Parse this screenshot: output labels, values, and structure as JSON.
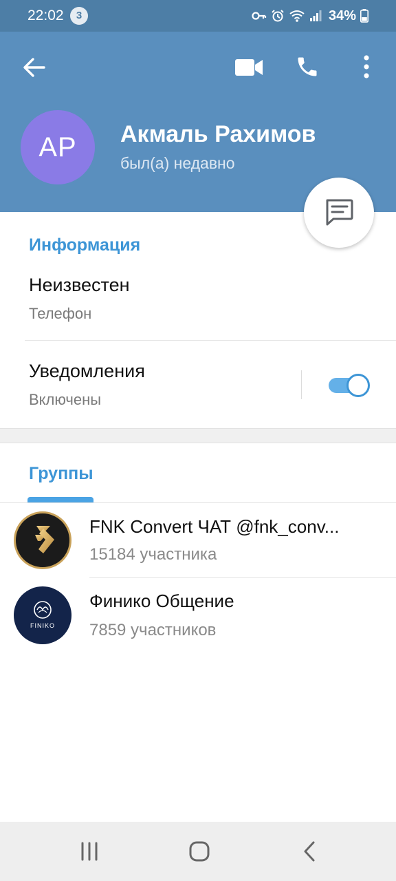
{
  "status_bar": {
    "time": "22:02",
    "notification_count": "3",
    "battery": "34%"
  },
  "header": {
    "avatar_initials": "AP",
    "name": "Акмаль Рахимов",
    "status": "был(а) недавно"
  },
  "info": {
    "section_title": "Информация",
    "phone_value": "Неизвестен",
    "phone_label": "Телефон",
    "notifications_label": "Уведомления",
    "notifications_value": "Включены",
    "notifications_enabled": true
  },
  "groups": {
    "section_title": "Группы",
    "items": [
      {
        "title": "FNK Convert ЧАТ @fnk_conv...",
        "members": "15184 участника"
      },
      {
        "title": "Финико Общение",
        "members": "7859 участников",
        "logo_text": "FINIKO"
      }
    ]
  },
  "colors": {
    "header_bg": "#5a8fbe",
    "status_bar_bg": "#4d7ea6",
    "accent": "#3d95d6",
    "avatar_bg": "#8a7be6"
  }
}
